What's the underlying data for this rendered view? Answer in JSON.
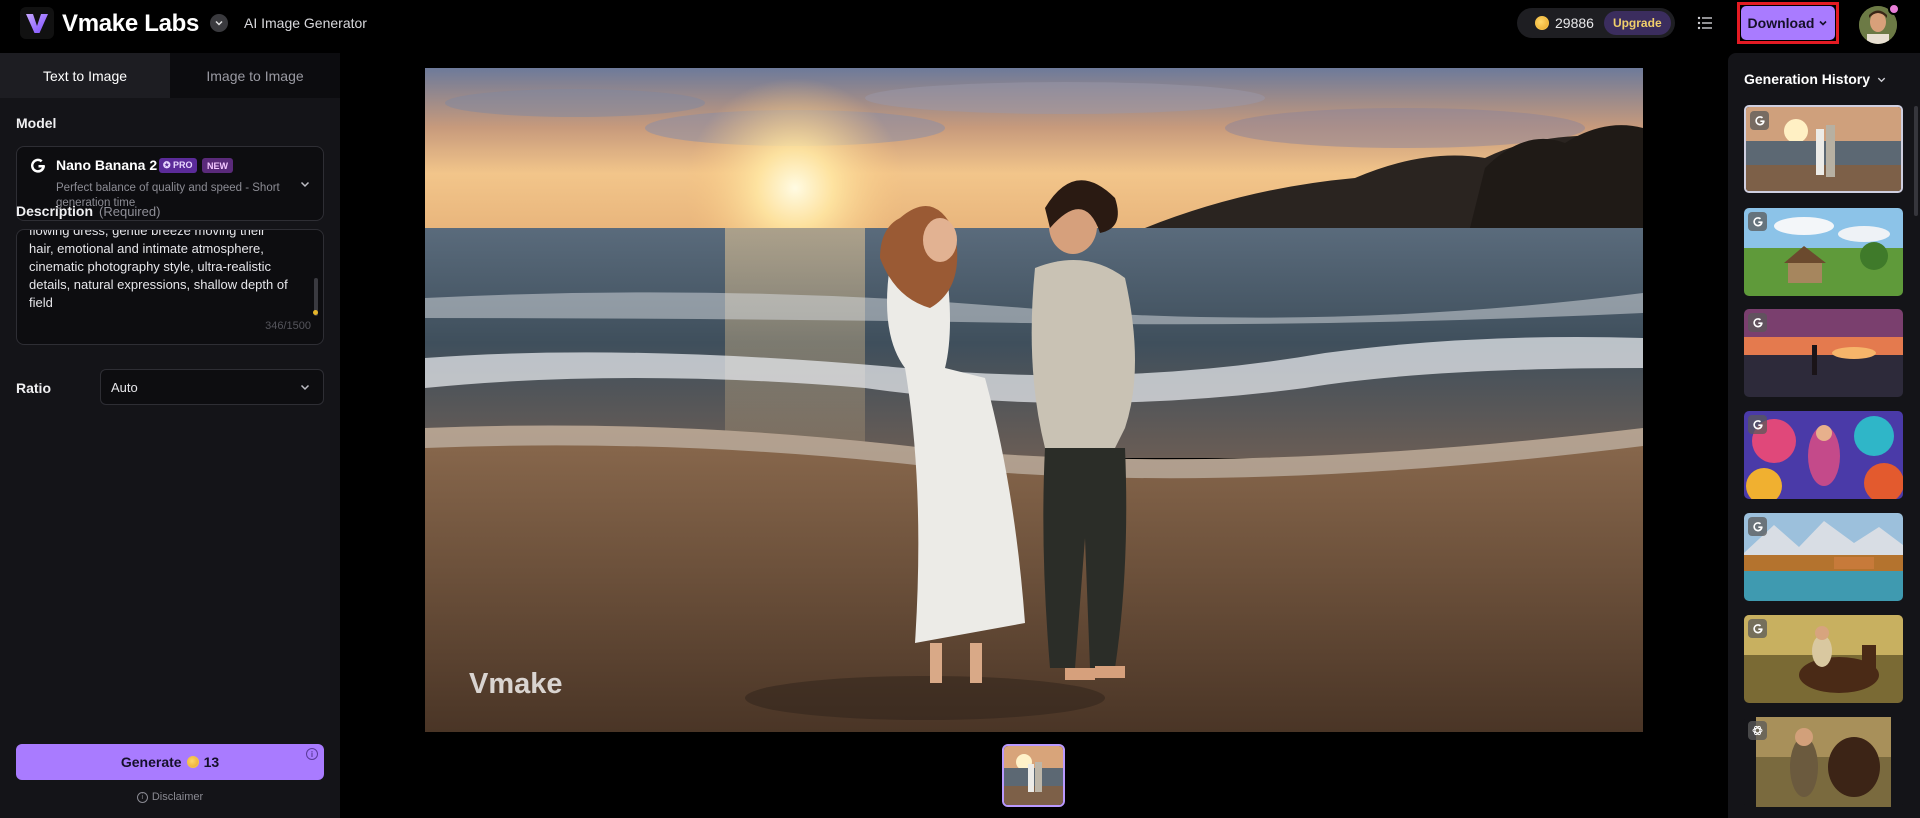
{
  "header": {
    "brand": "Vmake Labs",
    "subtitle": "AI Image Generator",
    "credits": "29886",
    "upgrade_label": "Upgrade",
    "download_label": "Download"
  },
  "tabs": [
    {
      "label": "Text to Image",
      "active": true
    },
    {
      "label": "Image to Image",
      "active": false
    }
  ],
  "model": {
    "section_label": "Model",
    "name": "Nano Banana 2",
    "badge_pro": "✪ PRO",
    "badge_new": "NEW",
    "description": "Perfect balance of quality and speed - Short generation time"
  },
  "description": {
    "section_label": "Description",
    "required_label": "(Required)",
    "lines": [
      "flowing dress, gentle breeze moving their",
      "hair, emotional and intimate atmosphere,",
      "cinematic photography style, ultra-realistic",
      "details, natural expressions, shallow depth of",
      "field"
    ],
    "char_count": "346/1500"
  },
  "ratio": {
    "label": "Ratio",
    "value": "Auto"
  },
  "generate": {
    "label": "Generate",
    "cost": "13",
    "disclaimer": "Disclaimer"
  },
  "main": {
    "watermark": "Vmake"
  },
  "history": {
    "title": "Generation History",
    "items": [
      {
        "subject": "beach couple sunset",
        "icon": "google-icon",
        "selected": true
      },
      {
        "subject": "cottage in green meadow",
        "icon": "google-icon",
        "selected": false
      },
      {
        "subject": "silhouette on sunset beach",
        "icon": "google-icon",
        "selected": false
      },
      {
        "subject": "colorful psychedelic woman",
        "icon": "google-icon",
        "selected": false
      },
      {
        "subject": "alpine lake village",
        "icon": "google-icon",
        "selected": false
      },
      {
        "subject": "woman riding horse",
        "icon": "google-icon",
        "selected": false
      },
      {
        "subject": "woman with horse",
        "icon": "openai-icon",
        "selected": false
      }
    ]
  },
  "colors": {
    "accent": "#a97bff",
    "highlight_outline": "#e41b23",
    "panel_bg": "#141418",
    "coin": "#e8a72a"
  }
}
